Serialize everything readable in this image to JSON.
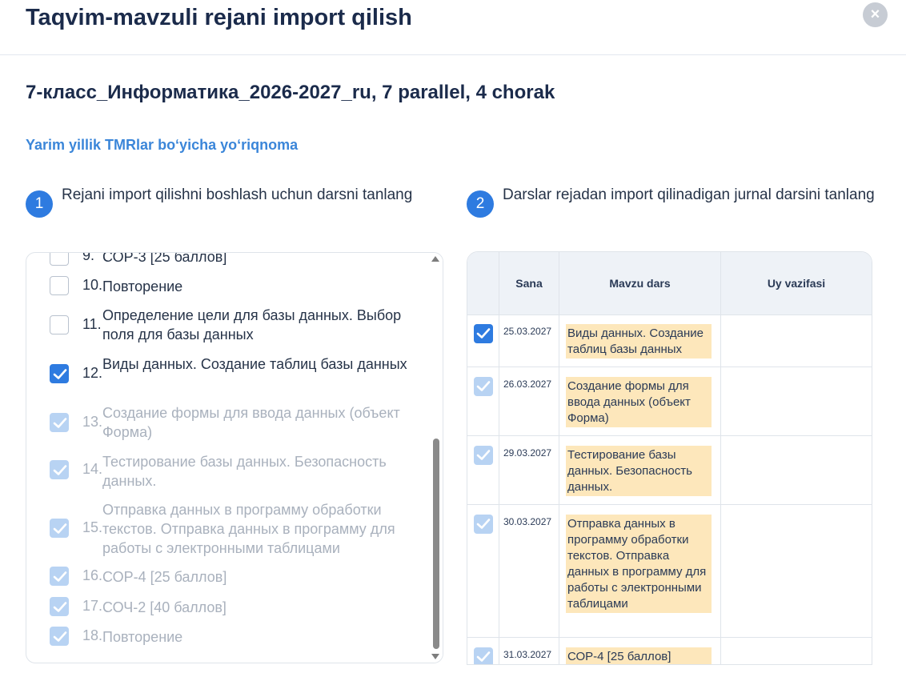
{
  "header": {
    "title": "Taqvim-mavzuli rejani import qilish",
    "close_icon": "×"
  },
  "plan_name": "7-класс_Информатика_2026-2027_ru, 7 parallel, 4 chorak",
  "guide_link": "Yarim yillik TMRlar boʻyicha yoʻriqnoma",
  "step1": {
    "num": "1",
    "text": "Rejani import qilishni boshlash uchun darsni tanlang"
  },
  "step2": {
    "num": "2",
    "text": "Darslar rejadan import qilinadigan jurnal darsini tanlang"
  },
  "lessons": [
    {
      "num": "9.",
      "title": "СОР-3 [25 баллов]",
      "state": "unchecked"
    },
    {
      "num": "10.",
      "title": "Повторение",
      "state": "unchecked"
    },
    {
      "num": "11.",
      "title": "Определение цели для базы данных. Выбор поля для базы данных",
      "state": "unchecked"
    },
    {
      "num": "12.",
      "title": "Виды данных. Создание таблиц базы данных",
      "state": "checked"
    },
    {
      "num": "13.",
      "title": "Создание формы для ввода данных (объект Форма)",
      "state": "dim"
    },
    {
      "num": "14.",
      "title": "Тестирование базы данных. Безопасность данных.",
      "state": "dim"
    },
    {
      "num": "15.",
      "title": "Отправка данных в программу обработки текстов. Отправка данных в программу для работы с электронными таблицами",
      "state": "dim"
    },
    {
      "num": "16.",
      "title": "СОР-4 [25 баллов]",
      "state": "dim"
    },
    {
      "num": "17.",
      "title": "СОЧ-2 [40 баллов]",
      "state": "dim"
    },
    {
      "num": "18.",
      "title": "Повторение",
      "state": "dim"
    }
  ],
  "table": {
    "columns": [
      "",
      "Sana",
      "Mavzu dars",
      "Uy vazifasi"
    ],
    "rows": [
      {
        "date": "25.03.2027",
        "topic": "Виды данных. Создание таблиц базы данных",
        "homework": "",
        "state": "checked"
      },
      {
        "date": "26.03.2027",
        "topic": "Создание формы для ввода данных (объект Форма)",
        "homework": "",
        "state": "dim"
      },
      {
        "date": "29.03.2027",
        "topic": "Тестирование базы данных. Безопасность данных.",
        "homework": "",
        "state": "dim"
      },
      {
        "date": "30.03.2027",
        "topic": "Отправка данных в программу обработки текстов. Отправка данных в программу для работы с электронными таблицами",
        "homework": "",
        "state": "dim"
      },
      {
        "date": "31.03.2027",
        "topic": "СОР-4 [25 баллов]",
        "homework": "",
        "state": "dim"
      }
    ]
  },
  "colors": {
    "accent": "#2e7be0",
    "accent_dim": "#b8d3f3",
    "title": "#1b2b4b",
    "link": "#3b86d9",
    "topic_highlight": "#fde7bb",
    "table_header_bg": "#eef2f7"
  }
}
